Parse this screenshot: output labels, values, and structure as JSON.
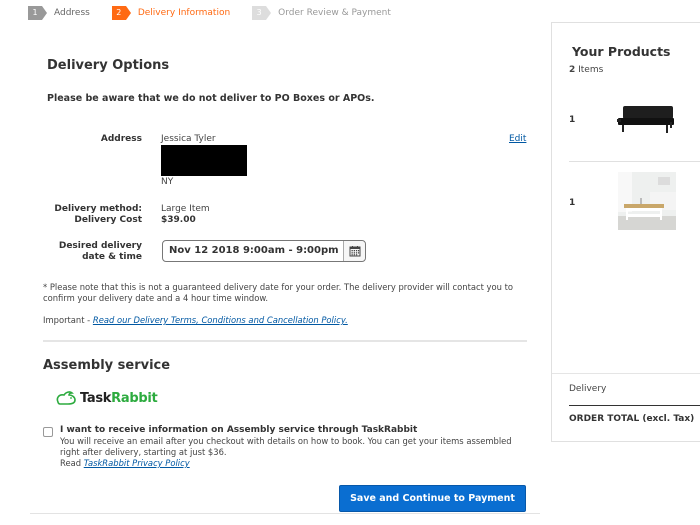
{
  "steps": [
    {
      "num": "1",
      "label": "Address",
      "state": "done"
    },
    {
      "num": "2",
      "label": "Delivery Information",
      "state": "active"
    },
    {
      "num": "3",
      "label": "Order Review & Payment",
      "state": "todo"
    }
  ],
  "delivery": {
    "title": "Delivery Options",
    "warning": "Please be aware that we do not deliver to PO Boxes or APOs.",
    "address_label": "Address",
    "address_name": "Jessica Tyler",
    "address_state": "NY",
    "edit_label": "Edit",
    "method_label": "Delivery method:",
    "cost_label": "Delivery Cost",
    "method_value": "Large Item",
    "cost_value": "$39.00",
    "date_label_1": "Desired delivery",
    "date_label_2": "date & time",
    "date_value": "Nov 12 2018 9:00am - 9:00pm",
    "note": "* Please note that this is not a guaranteed delivery date for your order. The delivery provider will contact you to confirm your delivery date and a 4 hour time window.",
    "important_prefix": "Important - ",
    "important_link": "Read our Delivery Terms, Conditions and Cancellation Policy."
  },
  "assembly": {
    "title": "Assembly service",
    "logo_task": "Task",
    "logo_rabbit": "Rabbit",
    "checkbox_checked": false,
    "checkbox_label": "I want to receive information on Assembly service through TaskRabbit",
    "description": "You will receive an email after you checkout with details on how to book. You can get your items assembled right after delivery, starting at just $36.",
    "read_prefix": "Read ",
    "privacy_link": "TaskRabbit Privacy Policy"
  },
  "save_button": "Save and Continue to Payment",
  "products": {
    "title": "Your Products",
    "count": "2",
    "count_suffix": " Items",
    "items": [
      {
        "qty": "1",
        "image": "black-sofa-bed"
      },
      {
        "qty": "1",
        "image": "white-coffee-table"
      }
    ],
    "delivery_label": "Delivery",
    "total_label": "ORDER TOTAL (excl. Tax)"
  },
  "colors": {
    "accent": "#ff6a13",
    "primary_button": "#0a6ed1",
    "link": "#0058a3",
    "taskrabbit_green": "#2dab3f"
  }
}
